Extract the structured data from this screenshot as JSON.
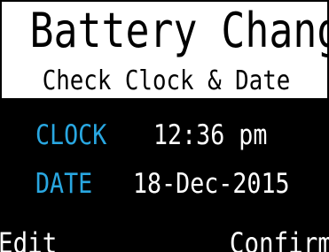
{
  "header": {
    "title": "Battery Changed",
    "subtitle": "Check Clock & Date"
  },
  "fields": {
    "clock": {
      "label": "CLOCK",
      "value": "12:36 pm"
    },
    "date": {
      "label": "DATE",
      "value": "18-Dec-2015"
    }
  },
  "softkeys": {
    "left": "Edit",
    "right": "Confirm"
  },
  "colors": {
    "background": "#000000",
    "header_background": "#ffffff",
    "label_color": "#29a7e1",
    "text_color": "#ffffff"
  }
}
